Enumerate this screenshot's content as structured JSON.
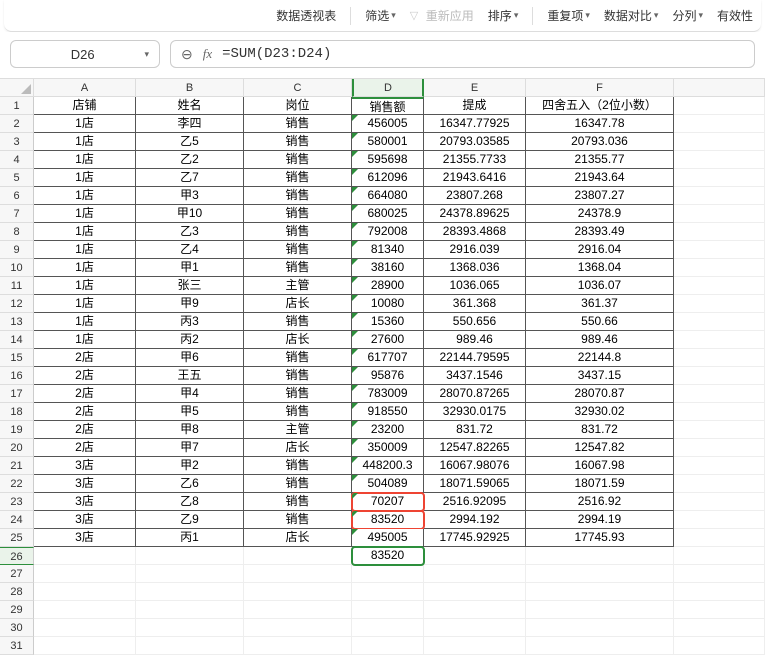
{
  "toolbar": {
    "pivot": "数据透视表",
    "filter": "筛选",
    "reapply": "重新应用",
    "sort": "排序",
    "duplicates": "重复项",
    "compare": "数据对比",
    "split": "分列",
    "validity": "有效性"
  },
  "nameBox": "D26",
  "formula": "=SUM(D23:D24)",
  "columns": [
    "A",
    "B",
    "C",
    "D",
    "E",
    "F",
    ""
  ],
  "headers": [
    "店铺",
    "姓名",
    "岗位",
    "销售额",
    "提成",
    "四舍五入（2位小数）"
  ],
  "rows": [
    [
      "1店",
      "李四",
      "销售",
      "456005",
      "16347.77925",
      "16347.78"
    ],
    [
      "1店",
      "乙5",
      "销售",
      "580001",
      "20793.03585",
      "20793.036"
    ],
    [
      "1店",
      "乙2",
      "销售",
      "595698",
      "21355.7733",
      "21355.77"
    ],
    [
      "1店",
      "乙7",
      "销售",
      "612096",
      "21943.6416",
      "21943.64"
    ],
    [
      "1店",
      "甲3",
      "销售",
      "664080",
      "23807.268",
      "23807.27"
    ],
    [
      "1店",
      "甲10",
      "销售",
      "680025",
      "24378.89625",
      "24378.9"
    ],
    [
      "1店",
      "乙3",
      "销售",
      "792008",
      "28393.4868",
      "28393.49"
    ],
    [
      "1店",
      "乙4",
      "销售",
      "81340",
      "2916.039",
      "2916.04"
    ],
    [
      "1店",
      "甲1",
      "销售",
      "38160",
      "1368.036",
      "1368.04"
    ],
    [
      "1店",
      "张三",
      "主管",
      "28900",
      "1036.065",
      "1036.07"
    ],
    [
      "1店",
      "甲9",
      "店长",
      "10080",
      "361.368",
      "361.37"
    ],
    [
      "1店",
      "丙3",
      "销售",
      "15360",
      "550.656",
      "550.66"
    ],
    [
      "1店",
      "丙2",
      "店长",
      "27600",
      "989.46",
      "989.46"
    ],
    [
      "2店",
      "甲6",
      "销售",
      "617707",
      "22144.79595",
      "22144.8"
    ],
    [
      "2店",
      "王五",
      "销售",
      "95876",
      "3437.1546",
      "3437.15"
    ],
    [
      "2店",
      "甲4",
      "销售",
      "783009",
      "28070.87265",
      "28070.87"
    ],
    [
      "2店",
      "甲5",
      "销售",
      "918550",
      "32930.0175",
      "32930.02"
    ],
    [
      "2店",
      "甲8",
      "主管",
      "23200",
      "831.72",
      "831.72"
    ],
    [
      "2店",
      "甲7",
      "店长",
      "350009",
      "12547.82265",
      "12547.82"
    ],
    [
      "3店",
      "甲2",
      "销售",
      "448200.3",
      "16067.98076",
      "16067.98"
    ],
    [
      "3店",
      "乙6",
      "销售",
      "504089",
      "18071.59065",
      "18071.59"
    ],
    [
      "3店",
      "乙8",
      "销售",
      "70207",
      "2516.92095",
      "2516.92"
    ],
    [
      "3店",
      "乙9",
      "销售",
      "83520",
      "2994.192",
      "2994.19"
    ],
    [
      "3店",
      "丙1",
      "店长",
      "495005",
      "17745.92925",
      "17745.93"
    ]
  ],
  "activeCell": {
    "row": 26,
    "col": "D",
    "value": "83520"
  }
}
